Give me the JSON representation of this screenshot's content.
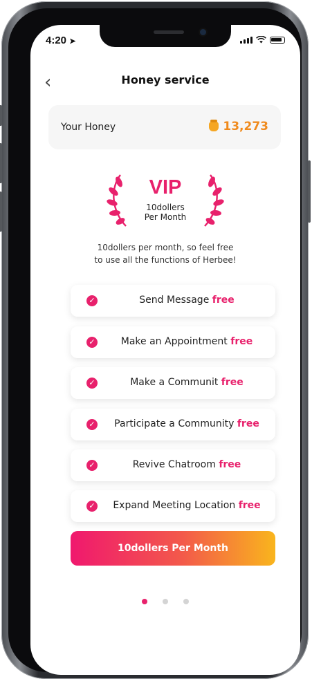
{
  "status": {
    "time": "4:20"
  },
  "header": {
    "title": "Honey service"
  },
  "honey": {
    "label": "Your Honey",
    "value": "13,273"
  },
  "plan": {
    "badge": "VIP",
    "price_line1": "10dollers",
    "price_line2": "Per Month",
    "desc_line1": "10dollers per month, so feel free",
    "desc_line2": "to use all the functions of Herbee!"
  },
  "features": [
    {
      "label": "Send Message",
      "tag": "free"
    },
    {
      "label": "Make an Appointment",
      "tag": "free"
    },
    {
      "label": "Make a Communit",
      "tag": "free"
    },
    {
      "label": "Participate a Community",
      "tag": "free"
    },
    {
      "label": "Revive Chatroom",
      "tag": "free"
    },
    {
      "label": "Expand Meeting Location",
      "tag": "free"
    }
  ],
  "cta": {
    "label": "10dollers Per Month"
  },
  "pagination": {
    "current": 1,
    "total": 3
  },
  "colors": {
    "accent": "#e8216c",
    "honey": "#f08a1c",
    "gradient_end": "#f9b51d"
  }
}
